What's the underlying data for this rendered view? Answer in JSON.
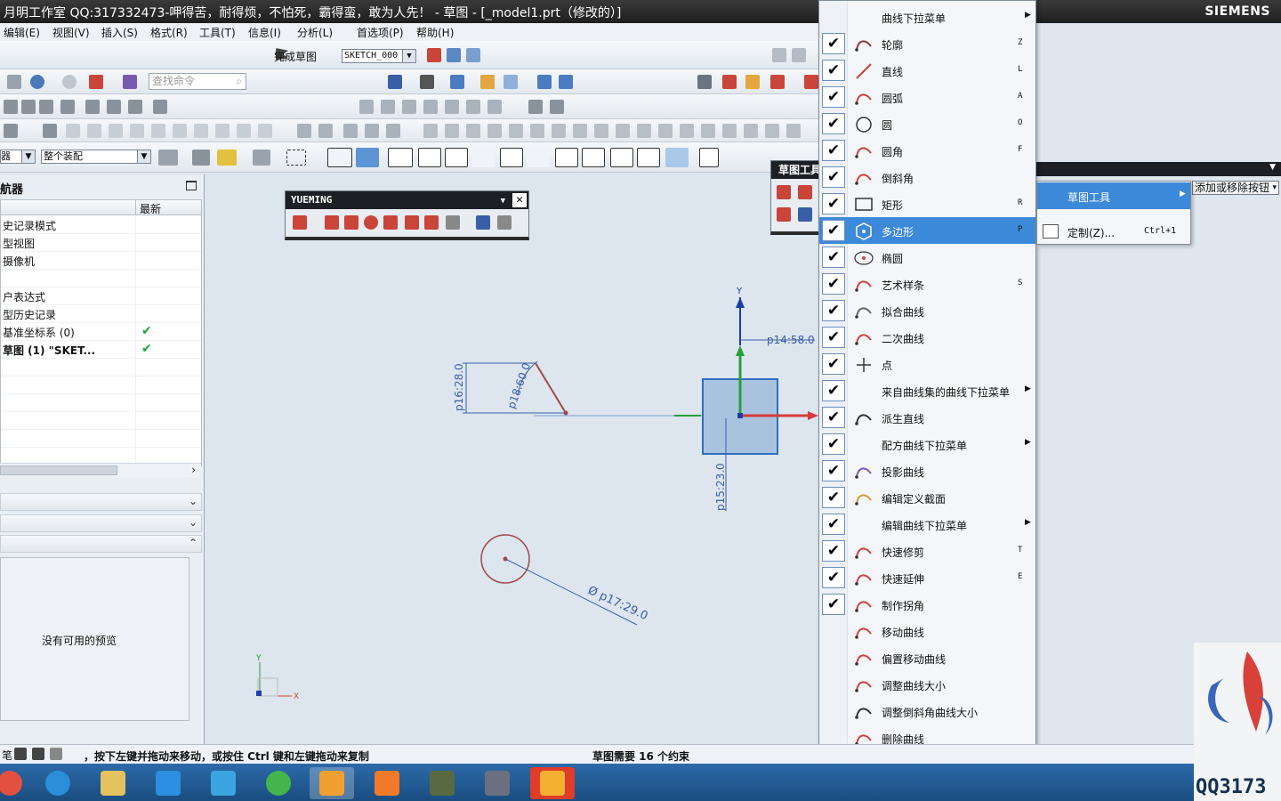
{
  "window": {
    "title": "月明工作室 QQ:317332473-呷得苦，耐得烦，不怕死，霸得蛮，敢为人先！ - 草图 - [_model1.prt（修改的）]",
    "brand": "SIEMENS"
  },
  "menubar": [
    "编辑(E)",
    "视图(V)",
    "插入(S)",
    "格式(R)",
    "工具(T)",
    "信息(I)",
    "分析(L)",
    "首选项(P)",
    "帮助(H)"
  ],
  "toolbar": {
    "finish_sketch": "完成草图",
    "sketch_name": "SKETCH_000",
    "search_placeholder": "查找命令",
    "filter1": "器",
    "filter2": "整个装配"
  },
  "navigator": {
    "title": "航器",
    "col_latest": "最新",
    "rows": [
      {
        "label": "史记录模式",
        "ok": false
      },
      {
        "label": "型视图",
        "ok": false
      },
      {
        "label": "摄像机",
        "ok": false
      },
      {
        "label": "",
        "ok": false
      },
      {
        "label": "户表达式",
        "ok": false
      },
      {
        "label": "型历史记录",
        "ok": false
      },
      {
        "label": "基准坐标系 (0)",
        "ok": true
      },
      {
        "label": "草图 (1) \"SKET...",
        "ok": true
      }
    ],
    "preview_text": "没有可用的预览"
  },
  "floating": {
    "yueming_title": "YUEMING",
    "sketch_tools_title": "草图工具"
  },
  "sketch": {
    "dims": [
      "p14:58.0",
      "p16:28.0",
      "p18:60.0",
      "p15:23.0",
      "Ø p17:29.0"
    ],
    "axis_x": "X",
    "axis_y": "Y"
  },
  "menu": {
    "items": [
      {
        "label": "曲线下拉菜单",
        "checked": false,
        "sub": true,
        "shortcut": "",
        "icon": "none"
      },
      {
        "label": "轮廓",
        "checked": true,
        "sub": false,
        "shortcut": "Z",
        "icon": "profile-icon"
      },
      {
        "label": "直线",
        "checked": true,
        "sub": false,
        "shortcut": "L",
        "icon": "line-icon"
      },
      {
        "label": "圆弧",
        "checked": true,
        "sub": false,
        "shortcut": "A",
        "icon": "arc-icon"
      },
      {
        "label": "圆",
        "checked": true,
        "sub": false,
        "shortcut": "O",
        "icon": "circle-icon"
      },
      {
        "label": "圆角",
        "checked": true,
        "sub": false,
        "shortcut": "F",
        "icon": "fillet-icon"
      },
      {
        "label": "倒斜角",
        "checked": true,
        "sub": false,
        "shortcut": "",
        "icon": "chamfer-icon"
      },
      {
        "label": "矩形",
        "checked": true,
        "sub": false,
        "shortcut": "R",
        "icon": "rectangle-icon"
      },
      {
        "label": "多边形",
        "checked": true,
        "sub": false,
        "shortcut": "P",
        "icon": "polygon-icon",
        "highlight": true
      },
      {
        "label": "椭圆",
        "checked": true,
        "sub": false,
        "shortcut": "",
        "icon": "ellipse-icon"
      },
      {
        "label": "艺术样条",
        "checked": true,
        "sub": false,
        "shortcut": "S",
        "icon": "spline-icon"
      },
      {
        "label": "拟合曲线",
        "checked": true,
        "sub": false,
        "shortcut": "",
        "icon": "fit-curve-icon"
      },
      {
        "label": "二次曲线",
        "checked": true,
        "sub": false,
        "shortcut": "",
        "icon": "conic-icon"
      },
      {
        "label": "点",
        "checked": true,
        "sub": false,
        "shortcut": "",
        "icon": "point-icon"
      },
      {
        "label": "来自曲线集的曲线下拉菜单",
        "checked": true,
        "sub": true,
        "shortcut": "",
        "icon": "none"
      },
      {
        "label": "派生直线",
        "checked": true,
        "sub": false,
        "shortcut": "",
        "icon": "derived-line-icon"
      },
      {
        "label": "配方曲线下拉菜单",
        "checked": true,
        "sub": true,
        "shortcut": "",
        "icon": "none"
      },
      {
        "label": "投影曲线",
        "checked": true,
        "sub": false,
        "shortcut": "",
        "icon": "project-curve-icon"
      },
      {
        "label": "编辑定义截面",
        "checked": true,
        "sub": false,
        "shortcut": "",
        "icon": "edit-section-icon"
      },
      {
        "label": "编辑曲线下拉菜单",
        "checked": true,
        "sub": true,
        "shortcut": "",
        "icon": "none"
      },
      {
        "label": "快速修剪",
        "checked": true,
        "sub": false,
        "shortcut": "T",
        "icon": "quick-trim-icon"
      },
      {
        "label": "快速延伸",
        "checked": true,
        "sub": false,
        "shortcut": "E",
        "icon": "quick-extend-icon"
      },
      {
        "label": "制作拐角",
        "checked": true,
        "sub": false,
        "shortcut": "",
        "icon": "make-corner-icon"
      },
      {
        "label": "移动曲线",
        "checked": false,
        "sub": false,
        "shortcut": "",
        "icon": "move-curve-icon"
      },
      {
        "label": "偏置移动曲线",
        "checked": false,
        "sub": false,
        "shortcut": "",
        "icon": "offset-move-curve-icon"
      },
      {
        "label": "调整曲线大小",
        "checked": false,
        "sub": false,
        "shortcut": "",
        "icon": "resize-curve-icon"
      },
      {
        "label": "调整倒斜角曲线大小",
        "checked": false,
        "sub": false,
        "shortcut": "",
        "icon": "resize-chamfer-icon"
      },
      {
        "label": "删除曲线",
        "checked": false,
        "sub": false,
        "shortcut": "",
        "icon": "delete-curve-icon"
      }
    ],
    "more_arrow": "▾"
  },
  "submenu": {
    "items": [
      {
        "label": "草图工具",
        "sub": true,
        "highlight": true
      },
      {
        "label": "定制(Z)...",
        "shortcut": "Ctrl+1",
        "highlight": false
      }
    ],
    "add_remove": "添加或移除按钮"
  },
  "status": {
    "left": "，按下左键并拖动来移动，或按住 Ctrl 键和左键拖动来复制",
    "middle": "草图需要 16 个约束",
    "left_prefix": "笔"
  },
  "watermark": "QQ3173",
  "colors": {
    "highlight": "#3d89d9",
    "sketch_curve": "#a04848",
    "dimension": "#3b5fa8",
    "check": "#19a33b"
  }
}
